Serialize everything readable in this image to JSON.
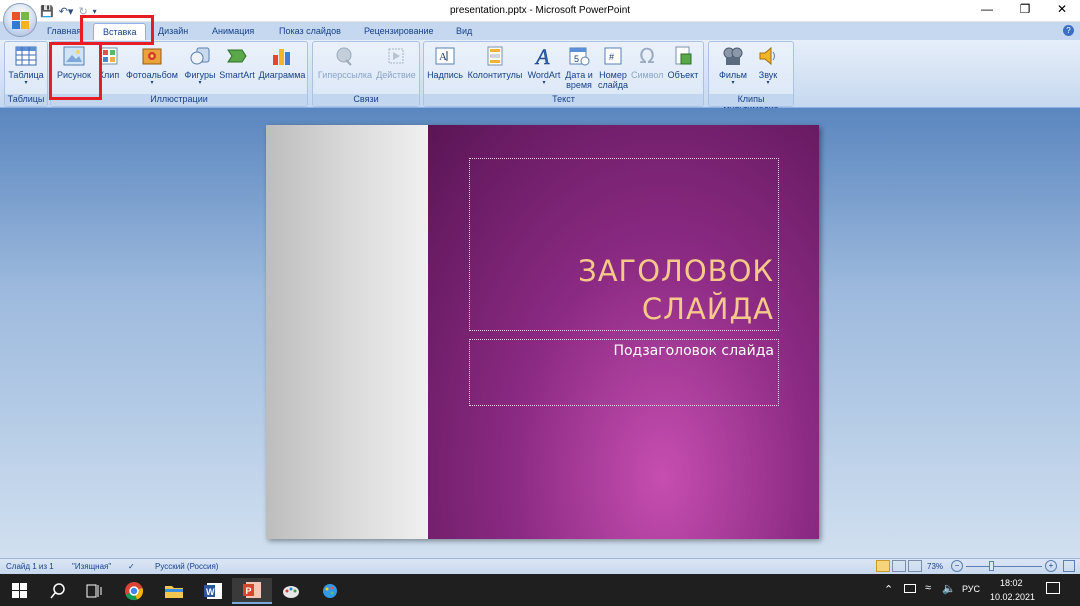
{
  "window": {
    "title": "presentation.pptx - Microsoft PowerPoint"
  },
  "tabs": [
    "Главная",
    "Вставка",
    "Дизайн",
    "Анимация",
    "Показ слайдов",
    "Рецензирование",
    "Вид"
  ],
  "ribbon": {
    "groups": {
      "tables": "Таблицы",
      "illustrations": "Иллюстрации",
      "links": "Связи",
      "text": "Текст",
      "media": "Клипы мультимедиа"
    },
    "buttons": {
      "table": "Таблица",
      "picture": "Рисунок",
      "clip": "Клип",
      "photoalbum": "Фотоальбом",
      "shapes": "Фигуры",
      "smartart": "SmartArt",
      "chart": "Диаграмма",
      "hyperlink": "Гиперссылка",
      "action": "Действие",
      "textbox": "Надпись",
      "header_footer": "Колонтитулы",
      "wordart": "WordArt",
      "datetime_1": "Дата и",
      "datetime_2": "время",
      "slidenum_1": "Номер",
      "slidenum_2": "слайда",
      "symbol": "Символ",
      "object": "Объект",
      "movie": "Фильм",
      "sound": "Звук"
    }
  },
  "slide": {
    "title_line1": "ЗАГОЛОВОК",
    "title_line2": "СЛАЙДА",
    "subtitle": "Подзаголовок слайда"
  },
  "status": {
    "slide": "Слайд 1 из 1",
    "theme": "\"Изящная\"",
    "language": "Русский (Россия)",
    "zoom": "73%"
  },
  "taskbar": {
    "lang": "РУС",
    "time": "18:02",
    "date": "10.02.2021"
  },
  "colors": {
    "highlight": "#e81c24",
    "slide_purple": "#8b2a83",
    "title_gold": "#f6c98a"
  }
}
